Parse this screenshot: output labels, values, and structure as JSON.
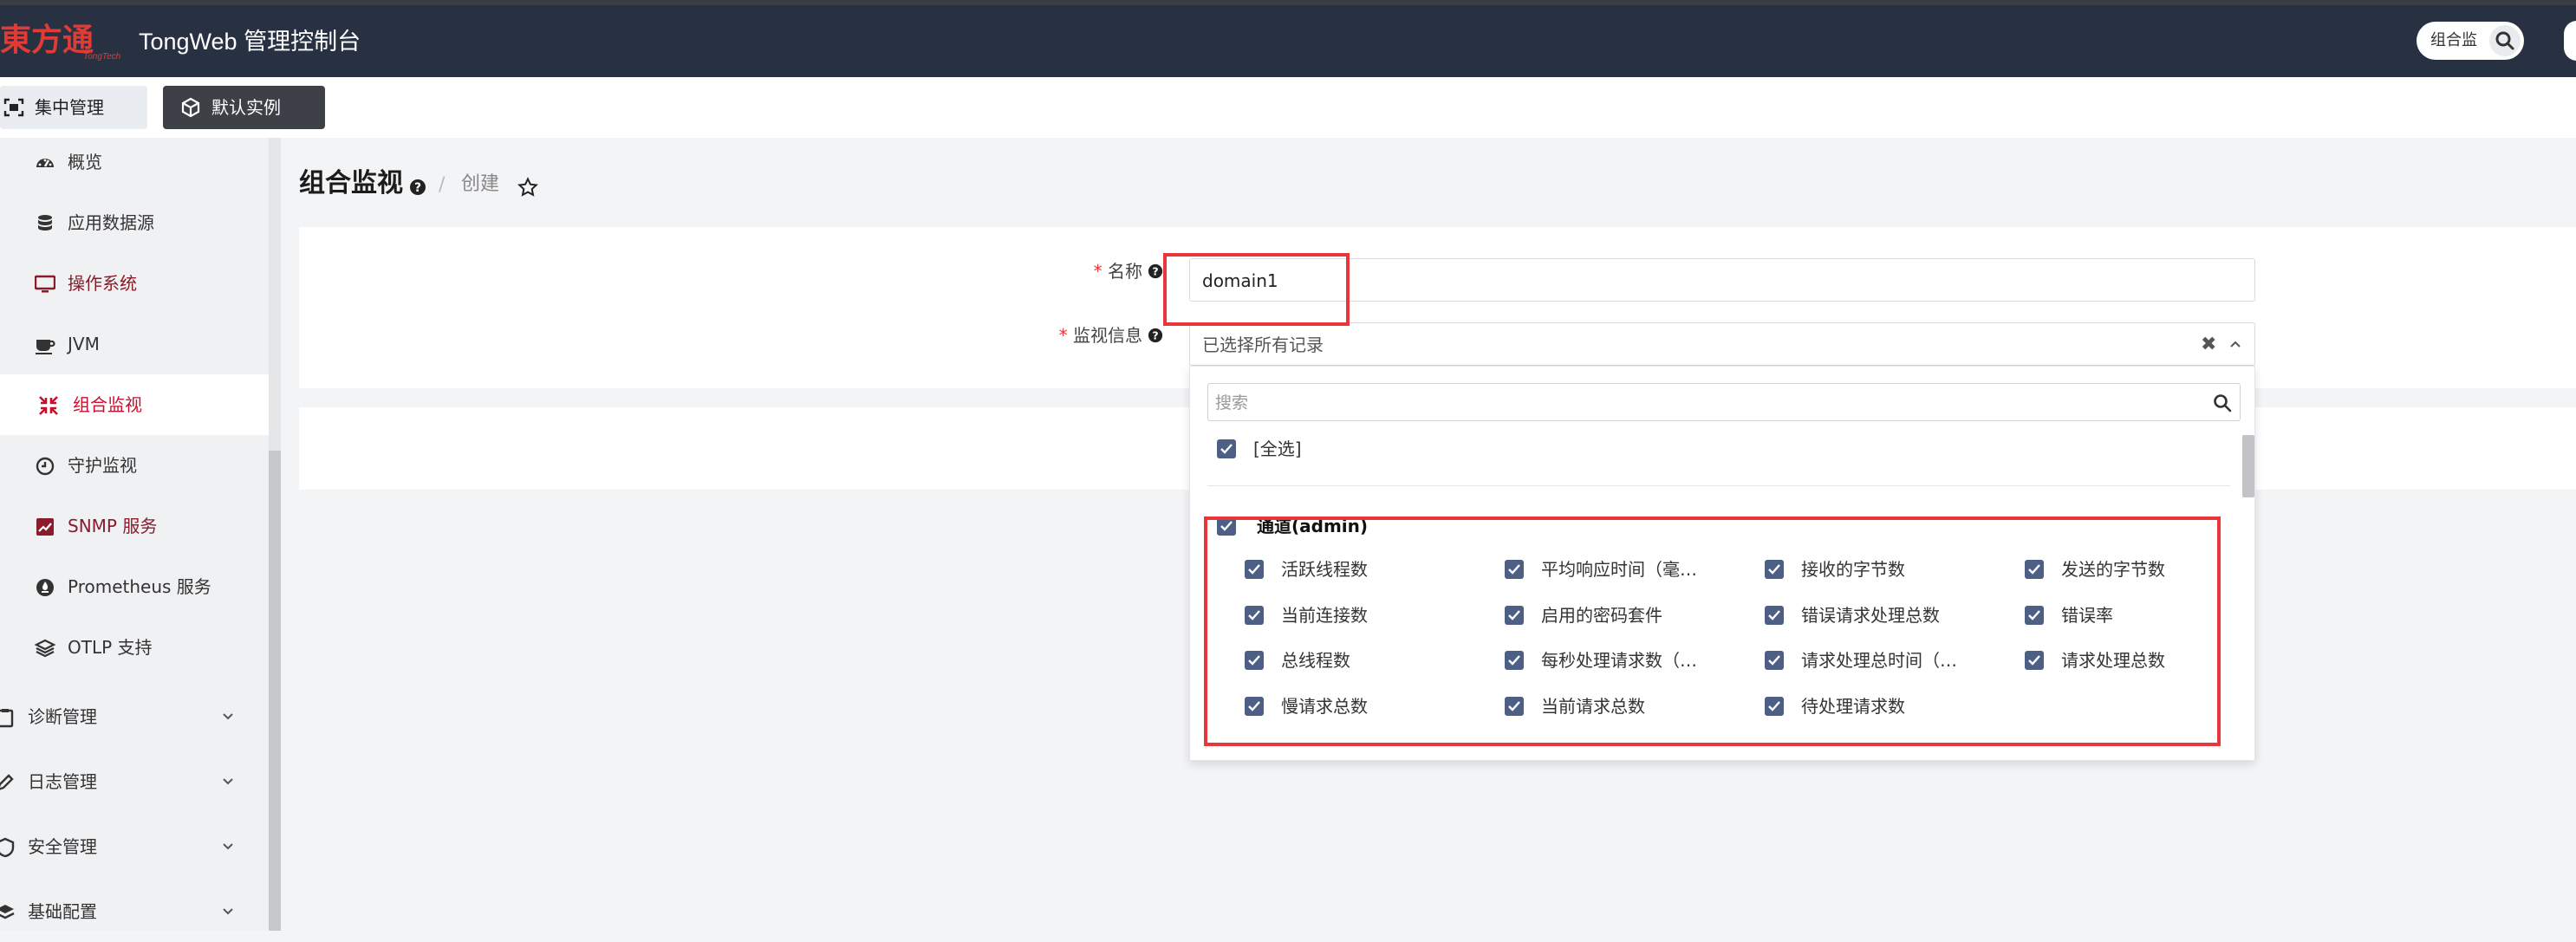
{
  "header": {
    "logo_text": "東方通",
    "logo_sub": "TongTech",
    "app_title": "TongWeb 管理控制台",
    "search_label": "组合监"
  },
  "tabs": {
    "central": "集中管理",
    "default_instance": "默认实例"
  },
  "sidebar": {
    "items": [
      {
        "label": "概览",
        "icon": "dashboard-icon"
      },
      {
        "label": "应用数据源",
        "icon": "database-icon"
      },
      {
        "label": "操作系统",
        "icon": "monitor-icon"
      },
      {
        "label": "JVM",
        "icon": "coffee-icon"
      },
      {
        "label": "组合监视",
        "icon": "combine-icon",
        "active": true
      },
      {
        "label": "守护监视",
        "icon": "clock-icon"
      },
      {
        "label": "SNMP 服务",
        "icon": "chart-icon"
      },
      {
        "label": "Prometheus 服务",
        "icon": "prometheus-icon"
      },
      {
        "label": "OTLP 支持",
        "icon": "layers-icon"
      }
    ],
    "groups": [
      {
        "label": "诊断管理",
        "icon": "clipboard-icon"
      },
      {
        "label": "日志管理",
        "icon": "edit-icon"
      },
      {
        "label": "安全管理",
        "icon": "shield-icon"
      },
      {
        "label": "基础配置",
        "icon": "stack-icon"
      }
    ]
  },
  "page": {
    "title": "组合监视",
    "crumb_sep": "/",
    "crumb": "创建"
  },
  "form": {
    "name_label": "名称",
    "name_value": "domain1",
    "monitor_label": "监视信息",
    "monitor_value": "已选择所有记录",
    "clear_glyph": "✖",
    "required_mark": "*"
  },
  "dropdown": {
    "search_placeholder": "搜索",
    "select_all": "[全选]",
    "group_label": "通道(admin)",
    "options": [
      "活跃线程数",
      "平均响应时间（毫…",
      "接收的字节数",
      "发送的字节数",
      "当前连接数",
      "启用的密码套件",
      "错误请求处理总数",
      "错误率",
      "总线程数",
      "每秒处理请求数（…",
      "请求处理总时间（…",
      "请求处理总数",
      "慢请求总数",
      "当前请求总数",
      "待处理请求数"
    ]
  },
  "colors": {
    "topbar": "#283142",
    "accent_red": "#c8102e",
    "checkbox": "#4e5f86",
    "highlight": "#e8363b"
  }
}
